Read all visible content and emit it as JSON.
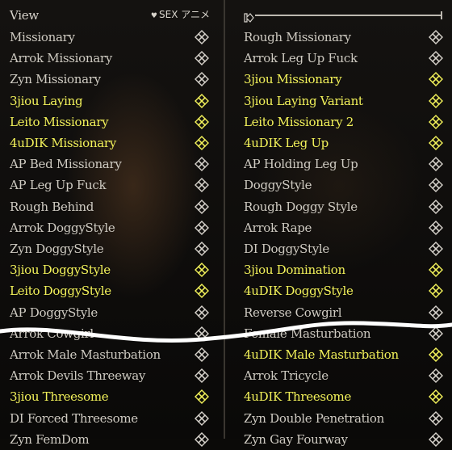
{
  "header": {
    "left_title": "View",
    "right_label": "SEX アニメ",
    "heart": "♥",
    "slider_value": 0.0
  },
  "left_items": [
    {
      "label": "Missionary",
      "highlighted": false
    },
    {
      "label": "Arrok Missionary",
      "highlighted": false
    },
    {
      "label": "Zyn Missionary",
      "highlighted": false
    },
    {
      "label": "3jiou Laying",
      "highlighted": true
    },
    {
      "label": "Leito Missionary",
      "highlighted": true
    },
    {
      "label": "4uDIK Missionary",
      "highlighted": true
    },
    {
      "label": "AP Bed Missionary",
      "highlighted": false
    },
    {
      "label": "AP Leg Up Fuck",
      "highlighted": false
    },
    {
      "label": "Rough Behind",
      "highlighted": false
    },
    {
      "label": "Arrok DoggyStyle",
      "highlighted": false
    },
    {
      "label": "Zyn DoggyStyle",
      "highlighted": false
    },
    {
      "label": "3jiou DoggyStyle",
      "highlighted": true
    },
    {
      "label": "Leito DoggyStyle",
      "highlighted": true
    },
    {
      "label": "AP DoggyStyle",
      "highlighted": false
    },
    {
      "label": "Arrok Cowgirl",
      "highlighted": false
    },
    {
      "label": "Arrok Male Masturbation",
      "highlighted": false
    },
    {
      "label": "Arrok Devils Threeway",
      "highlighted": false
    },
    {
      "label": "3jiou Threesome",
      "highlighted": true
    },
    {
      "label": "DI Forced Threesome",
      "highlighted": false
    },
    {
      "label": "Zyn FemDom",
      "highlighted": false
    }
  ],
  "right_items": [
    {
      "label": "Rough Missionary",
      "highlighted": false
    },
    {
      "label": "Arrok Leg Up Fuck",
      "highlighted": false
    },
    {
      "label": "3jiou Missionary",
      "highlighted": true
    },
    {
      "label": "3jiou Laying Variant",
      "highlighted": true
    },
    {
      "label": "Leito Missionary 2",
      "highlighted": true
    },
    {
      "label": "4uDIK Leg Up",
      "highlighted": true
    },
    {
      "label": "AP Holding Leg Up",
      "highlighted": false
    },
    {
      "label": "DoggyStyle",
      "highlighted": false
    },
    {
      "label": "Rough Doggy Style",
      "highlighted": false
    },
    {
      "label": "Arrok Rape",
      "highlighted": false
    },
    {
      "label": "DI DoggyStyle",
      "highlighted": false
    },
    {
      "label": "3jiou Domination",
      "highlighted": true
    },
    {
      "label": "4uDIK DoggyStyle",
      "highlighted": true
    },
    {
      "label": "Reverse Cowgirl",
      "highlighted": false
    },
    {
      "label": "Female Masturbation",
      "highlighted": false
    },
    {
      "label": "4uDIK Male Masturbation",
      "highlighted": true
    },
    {
      "label": "Arrok Tricycle",
      "highlighted": false
    },
    {
      "label": "4uDIK Threesome",
      "highlighted": true
    },
    {
      "label": "Zyn Double Penetration",
      "highlighted": false
    },
    {
      "label": "Zyn Gay Fourway",
      "highlighted": false
    }
  ],
  "icons": {
    "row_icon": "interlocked-diamond-icon",
    "slider_handle": "slider-handle-icon"
  },
  "colors": {
    "text": "#cfcbc2",
    "highlight": "#f3f25a",
    "background": "#0b0a08",
    "wave": "#ffffff"
  }
}
